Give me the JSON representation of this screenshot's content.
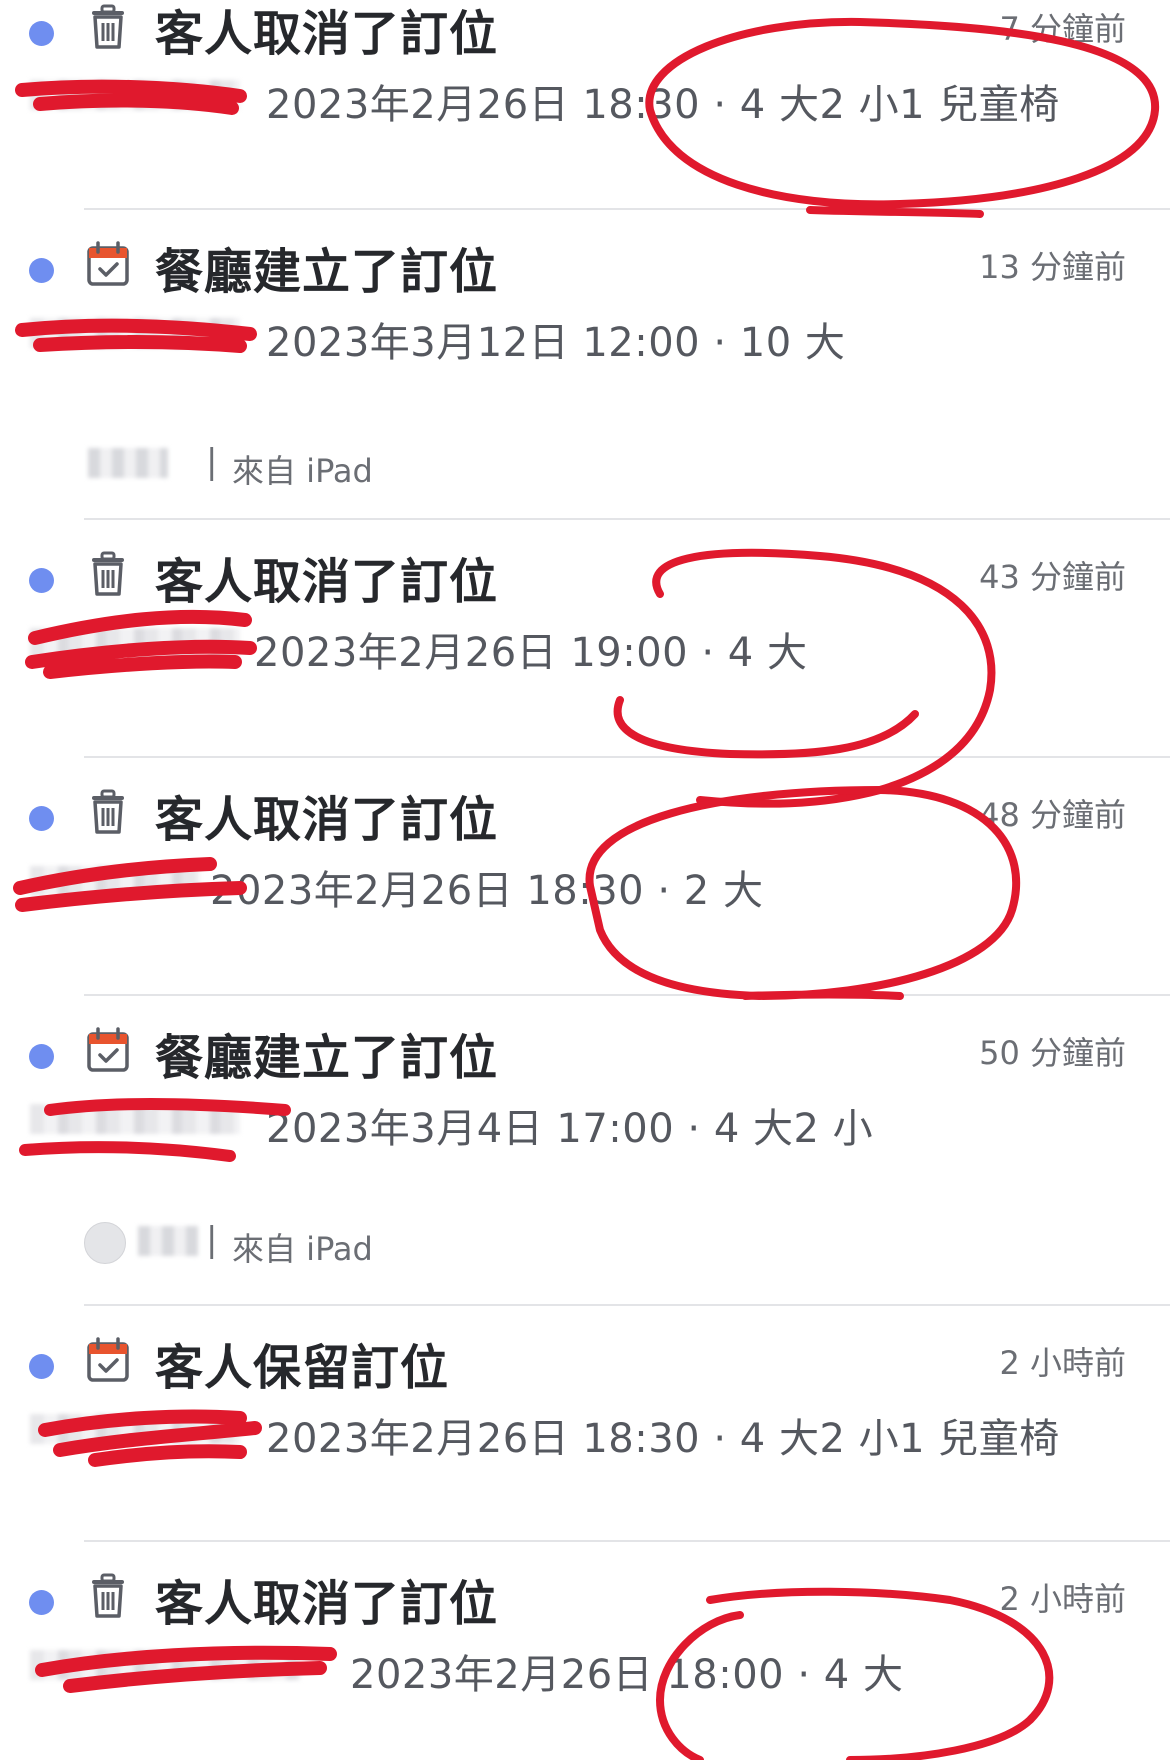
{
  "items": [
    {
      "icon": "trash-icon",
      "title": "客人取消了訂位",
      "time": "7 分鐘前",
      "detail": "2023年2月26日 18:30 · 4 大2 小1 兒童椅"
    },
    {
      "icon": "calendar-check-icon",
      "title": "餐廳建立了訂位",
      "time": "13 分鐘前",
      "detail": "2023年3月12日 12:00 · 10 大",
      "source": "來自 iPad"
    },
    {
      "icon": "trash-icon",
      "title": "客人取消了訂位",
      "time": "43 分鐘前",
      "detail": "2023年2月26日 19:00 · 4 大"
    },
    {
      "icon": "trash-icon",
      "title": "客人取消了訂位",
      "time": "48 分鐘前",
      "detail": "2023年2月26日 18:30 · 2 大"
    },
    {
      "icon": "calendar-check-icon",
      "title": "餐廳建立了訂位",
      "time": "50 分鐘前",
      "detail": "2023年3月4日 17:00 · 4 大2 小",
      "source": "來自 iPad"
    },
    {
      "icon": "calendar-check-icon",
      "title": "客人保留訂位",
      "time": "2 小時前",
      "detail": "2023年2月26日 18:30 · 4 大2 小1 兒童椅"
    },
    {
      "icon": "trash-icon",
      "title": "客人取消了訂位",
      "time": "2 小時前",
      "detail": "2023年2月26日 18:00 · 4 大"
    }
  ],
  "colors": {
    "unread_dot": "#6f8ef0",
    "calendar_accent": "#e8542e",
    "annotation": "#e0192d"
  }
}
